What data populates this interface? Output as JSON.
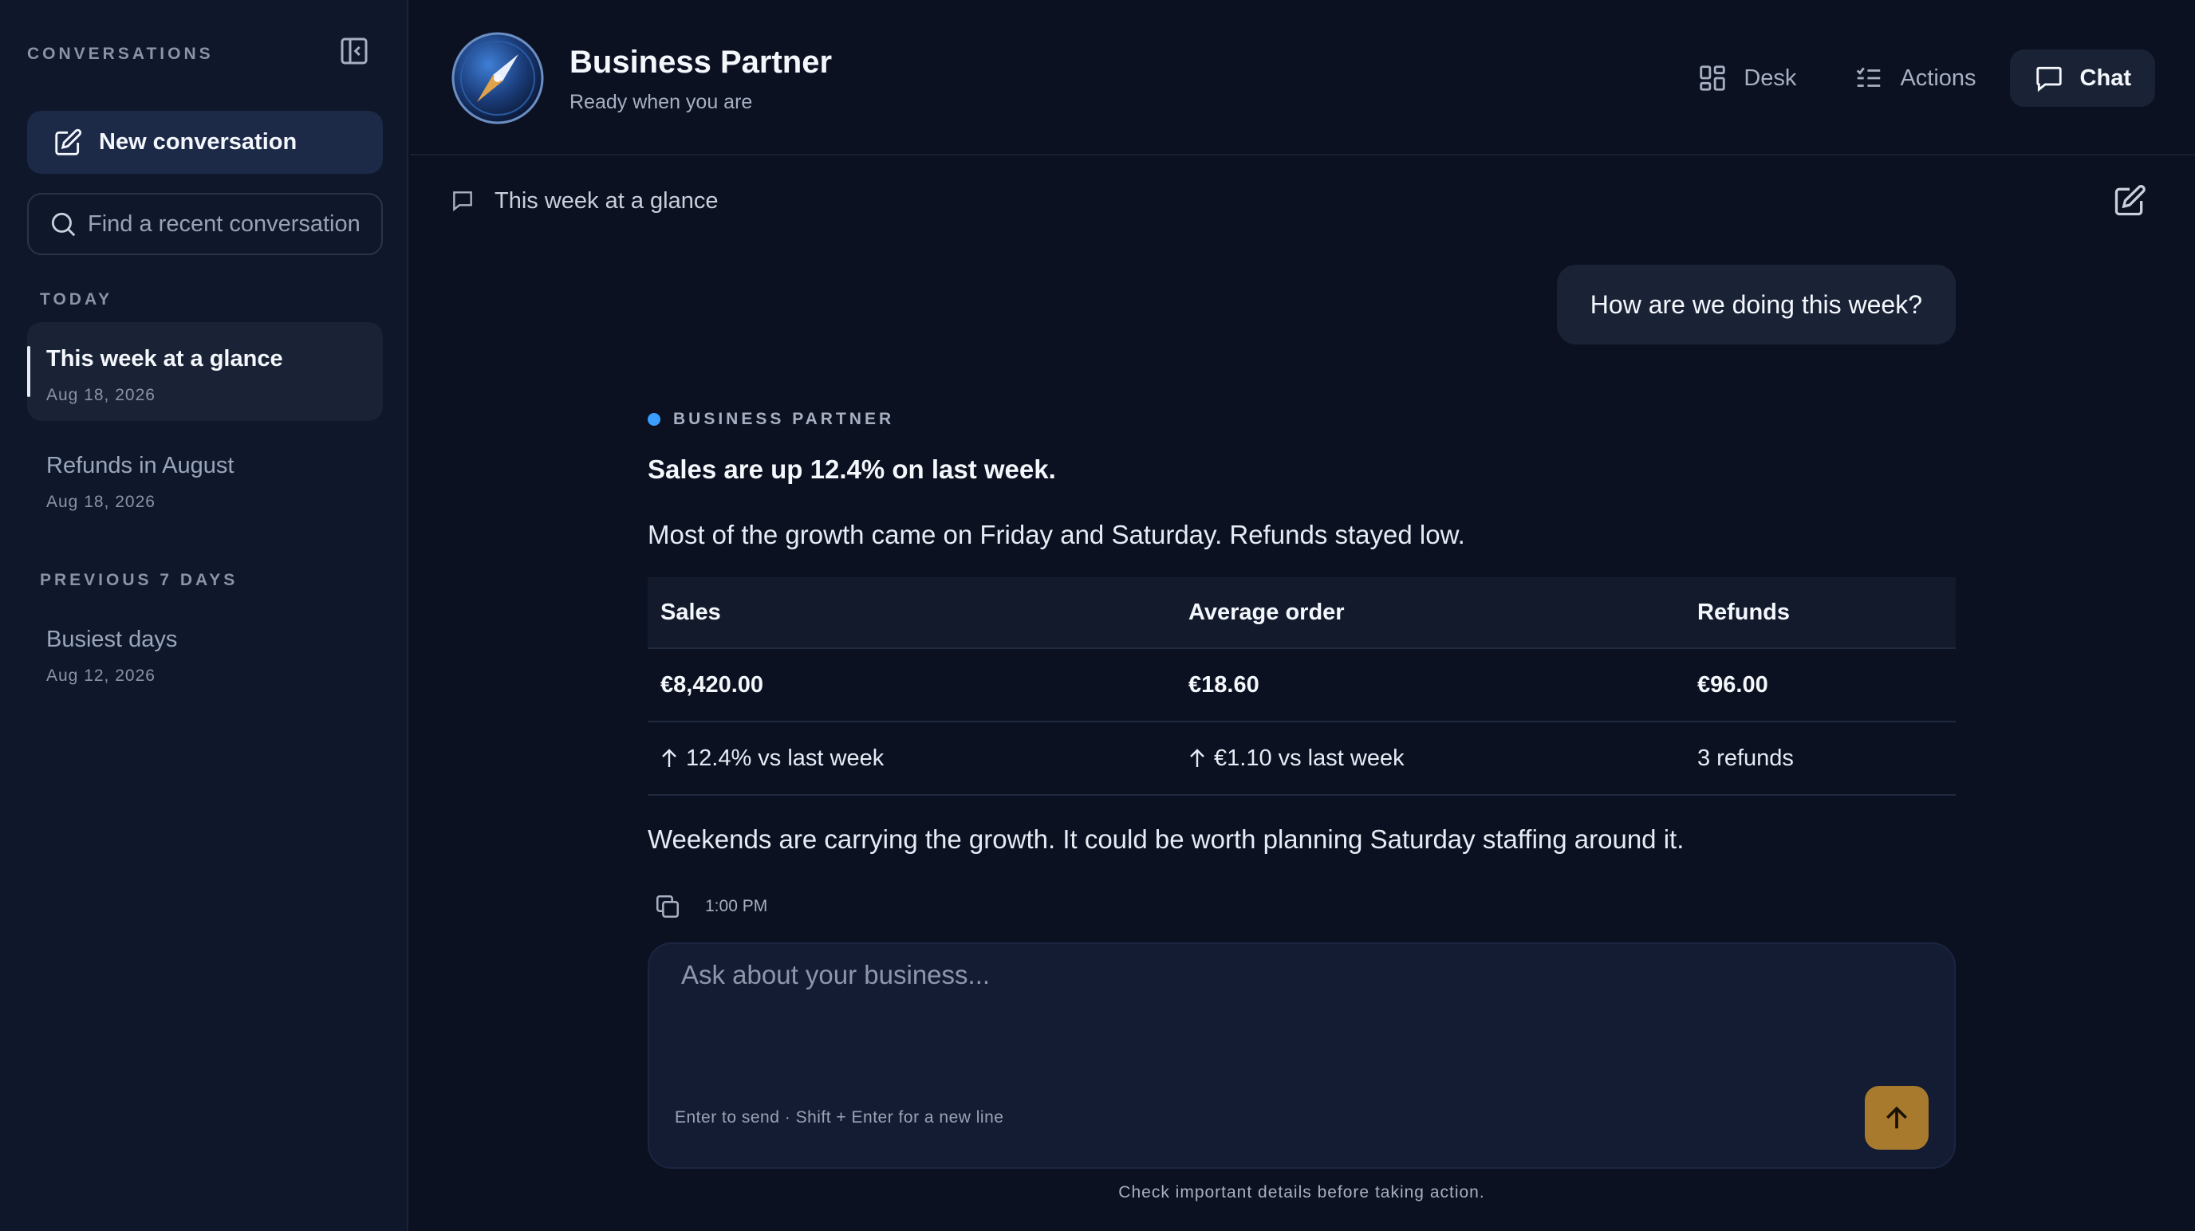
{
  "sidebar": {
    "title": "CONVERSATIONS",
    "new_conversation": "New conversation",
    "search_placeholder": "Find a recent conversation",
    "groups": [
      {
        "label": "TODAY",
        "items": [
          {
            "title": "This week at a glance",
            "date": "Aug 18, 2026",
            "active": true
          },
          {
            "title": "Refunds in August",
            "date": "Aug 18, 2026",
            "active": false
          }
        ]
      },
      {
        "label": "PREVIOUS 7 DAYS",
        "items": [
          {
            "title": "Busiest days",
            "date": "Aug 12, 2026",
            "active": false
          }
        ]
      }
    ]
  },
  "header": {
    "title": "Business Partner",
    "subtitle": "Ready when you are",
    "nav": [
      {
        "label": "Desk",
        "icon": "grid-icon",
        "active": false
      },
      {
        "label": "Actions",
        "icon": "list-check-icon",
        "active": false
      },
      {
        "label": "Chat",
        "icon": "chat-icon",
        "active": true
      }
    ]
  },
  "conversation": {
    "title": "This week at a glance",
    "user_message": "How are we doing this week?",
    "reply": {
      "tag": "BUSINESS PARTNER",
      "headline": "Sales are up 12.4% on last week.",
      "intro": "Most of the growth came on Friday and Saturday. Refunds stayed low.",
      "table": {
        "headers": [
          "Sales",
          "Average order",
          "Refunds"
        ],
        "values": [
          "€8,420.00",
          "€18.60",
          "€96.00"
        ],
        "changes": [
          "12.4% vs last week",
          "€1.10 vs last week",
          "3 refunds"
        ]
      },
      "closing": "Weekends are carrying the growth. It could be worth planning Saturday staffing around it.",
      "time": "1:00 PM"
    }
  },
  "composer": {
    "placeholder": "Ask about your business...",
    "hint": "Enter to send · Shift + Enter for a new line",
    "footer_note": "Check important details before taking action."
  },
  "colors": {
    "background": "#0b1120",
    "sidebar": "#0f172a",
    "accent_dot": "#3b9eff",
    "send_button": "#a87a2e"
  }
}
